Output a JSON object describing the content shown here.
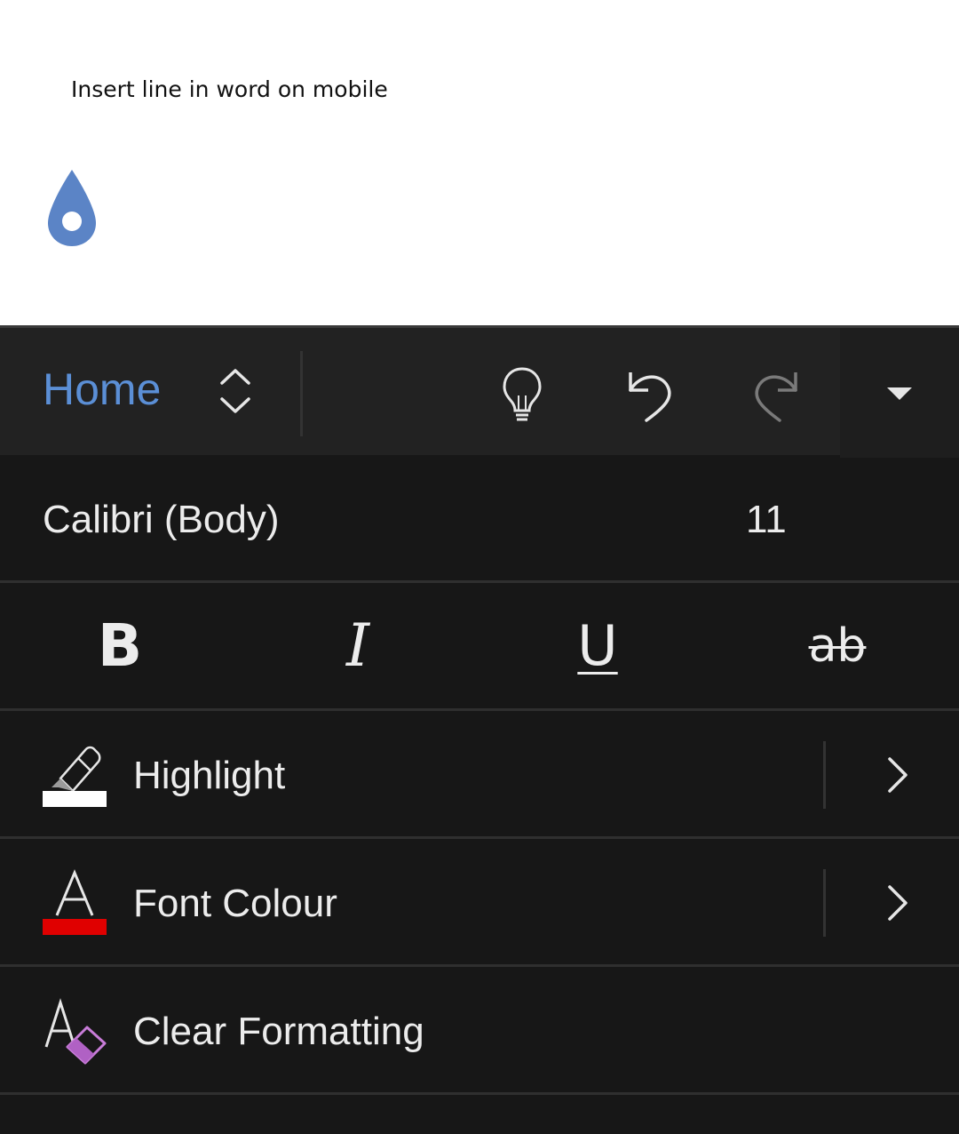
{
  "document": {
    "text": "Insert line in word on mobile"
  },
  "toolbar": {
    "tab_label": "Home",
    "buttons": [
      "lightbulb-icon",
      "undo-icon",
      "redo-icon",
      "dropdown-icon"
    ]
  },
  "font": {
    "name": "Calibri (Body)",
    "size": "11"
  },
  "formatting": {
    "bold": "B",
    "italic": "I",
    "underline": "U",
    "strikethrough": "ab"
  },
  "list": [
    {
      "label": "Highlight",
      "icon": "highlighter-icon",
      "swatch_color": "#ffffff"
    },
    {
      "label": "Font Colour",
      "icon": "font-color-icon",
      "swatch_color": "#e00000"
    },
    {
      "label": "Clear Formatting",
      "icon": "clear-formatting-icon"
    }
  ],
  "colors": {
    "accent": "#5b8fd6",
    "cursor_handle": "#5b84c6",
    "background": "#171717"
  }
}
